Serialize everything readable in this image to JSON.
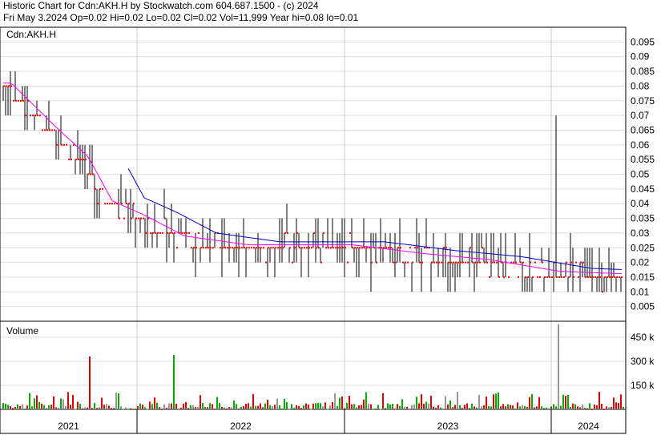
{
  "header": {
    "line1": "Historic Chart for Cdn:AKH.H by Stockwatch.com 604.687.1500 - (c) 2024",
    "line2": "Fri May  3.2024  Op=0.02  Hi=0.02  Lo=0.02  Cl=0.02  Vol=11,999  Year hi=0.08  lo=0.01"
  },
  "chart_data": [
    {
      "type": "bar",
      "title": "Cdn:AKH.H",
      "subtype": "price-high-low-close",
      "x_labels": [
        "2021",
        "2022",
        "2023",
        "2024"
      ],
      "ylim": [
        0,
        0.1
      ],
      "y_ticks": [
        "0.005",
        "0.01",
        "0.015",
        "0.02",
        "0.025",
        "0.03",
        "0.035",
        "0.04",
        "0.045",
        "0.05",
        "0.055",
        "0.06",
        "0.065",
        "0.07",
        "0.075",
        "0.08",
        "0.085",
        "0.09",
        "0.095"
      ],
      "grid": true,
      "colors": {
        "bars": "#000000",
        "close_marks": "#ff0000",
        "moving_average_fast": "#ff00ff",
        "moving_average_slow": "#0000cc"
      },
      "approx_price_levels": {
        "2021_start": 0.08,
        "2021_mid": 0.065,
        "2021_end": 0.035,
        "2022": 0.025,
        "2023": 0.02,
        "2024": 0.015
      },
      "notable_spike": {
        "period": "late 2023",
        "high": 0.07
      }
    },
    {
      "type": "bar",
      "title": "Volume",
      "y_ticks": [
        "150 k",
        "300 k",
        "450 k"
      ],
      "ylim": [
        0,
        550000
      ],
      "grid": true,
      "colors": {
        "up": "#00aa00",
        "down": "#dd0000",
        "unchanged": "#999999"
      },
      "notable_peaks": [
        {
          "period": "early 2021",
          "value": 330000
        },
        {
          "period": "late 2021",
          "value": 340000
        },
        {
          "period": "late 2023",
          "value": 530000
        }
      ]
    }
  ]
}
